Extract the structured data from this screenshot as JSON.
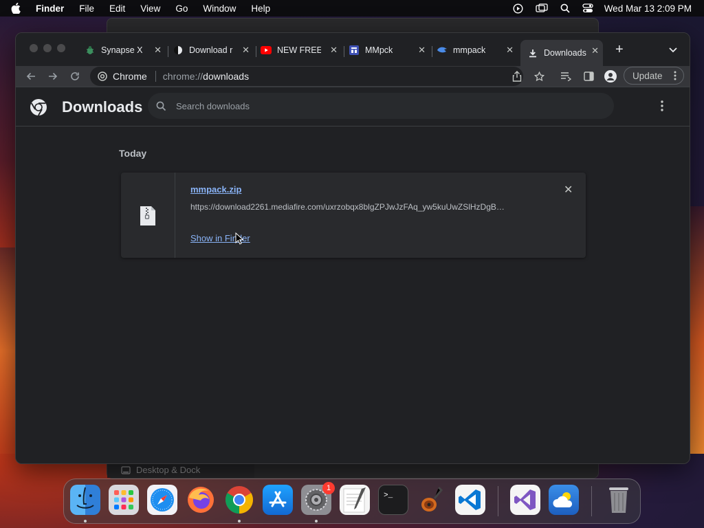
{
  "menubar": {
    "app_name": "Finder",
    "menus": [
      "File",
      "Edit",
      "View",
      "Go",
      "Window",
      "Help"
    ],
    "clock": "Wed Mar 13  2:09 PM"
  },
  "background_window": {
    "strip_label": "Desktop & Dock"
  },
  "chrome": {
    "tabs": [
      {
        "title": "Synapse X",
        "icon": "bug-icon"
      },
      {
        "title": "Download r",
        "icon": "dark-half-circle-icon"
      },
      {
        "title": "NEW FREE",
        "icon": "youtube-icon"
      },
      {
        "title": "MMpck",
        "icon": "mmpck-icon"
      },
      {
        "title": "mmpack",
        "icon": "mmpack-icon"
      },
      {
        "title": "Downloads",
        "icon": "download-icon",
        "active": true
      }
    ],
    "omnibox": {
      "chip_label": "Chrome",
      "url_scheme": "chrome://",
      "url_path": "downloads"
    },
    "update_label": "Update"
  },
  "downloads_page": {
    "title": "Downloads",
    "search_placeholder": "Search downloads",
    "section_label": "Today",
    "items": [
      {
        "file_name": "mmpack.zip",
        "url": "https://download2261.mediafire.com/uxrzobqx8blgZPJwJzFAq_yw5kuUwZSlHzDgB…",
        "action_label": "Show in Finder"
      }
    ]
  },
  "dock": {
    "apps": [
      "Finder",
      "Launchpad",
      "Safari",
      "Firefox",
      "Chrome",
      "App Store",
      "System Settings",
      "TextEdit",
      "Terminal",
      "GarageBand",
      "Visual Studio Code",
      "Visual Studio",
      "Weather",
      "Trash"
    ],
    "system_settings_badge": "1"
  },
  "colors": {
    "accent_link": "#8ab4f8",
    "chrome_bg": "#202124",
    "toolbar_bg": "#35363a",
    "badge_red": "#ff3b30"
  }
}
